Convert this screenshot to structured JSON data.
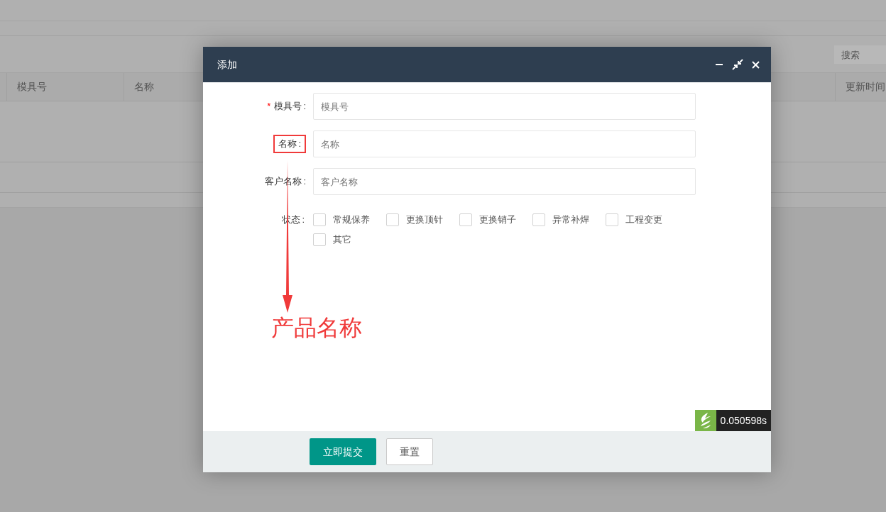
{
  "background": {
    "search": {
      "placeholder": "搜索"
    },
    "table": {
      "columns": [
        "模具号",
        "名称",
        "更新时间"
      ]
    }
  },
  "dialog": {
    "title": "添加",
    "fields": [
      {
        "required_mark": "*",
        "label": "模具号",
        "colon": ":",
        "highlighted": false,
        "placeholder": "模具号"
      },
      {
        "label": "名称",
        "colon": ":",
        "highlighted": true,
        "placeholder": "名称"
      },
      {
        "label": "客户名称",
        "colon": ":",
        "highlighted": false,
        "placeholder": "客户名称"
      }
    ],
    "status": {
      "label": "状态",
      "colon": ":",
      "options": [
        {
          "label": "常规保养",
          "checked": false
        },
        {
          "label": "更换顶针",
          "checked": false
        },
        {
          "label": "更换销子",
          "checked": false
        },
        {
          "label": "异常补焊",
          "checked": false
        },
        {
          "label": "工程变更",
          "checked": false
        },
        {
          "label": "其它",
          "checked": false
        }
      ]
    },
    "buttons": [
      {
        "label": "立即提交",
        "kind": "primary"
      },
      {
        "label": "重置",
        "kind": "secondary"
      }
    ]
  },
  "annotation": {
    "text": "产品名称"
  },
  "debug_badge": {
    "text": "0.050598s"
  }
}
